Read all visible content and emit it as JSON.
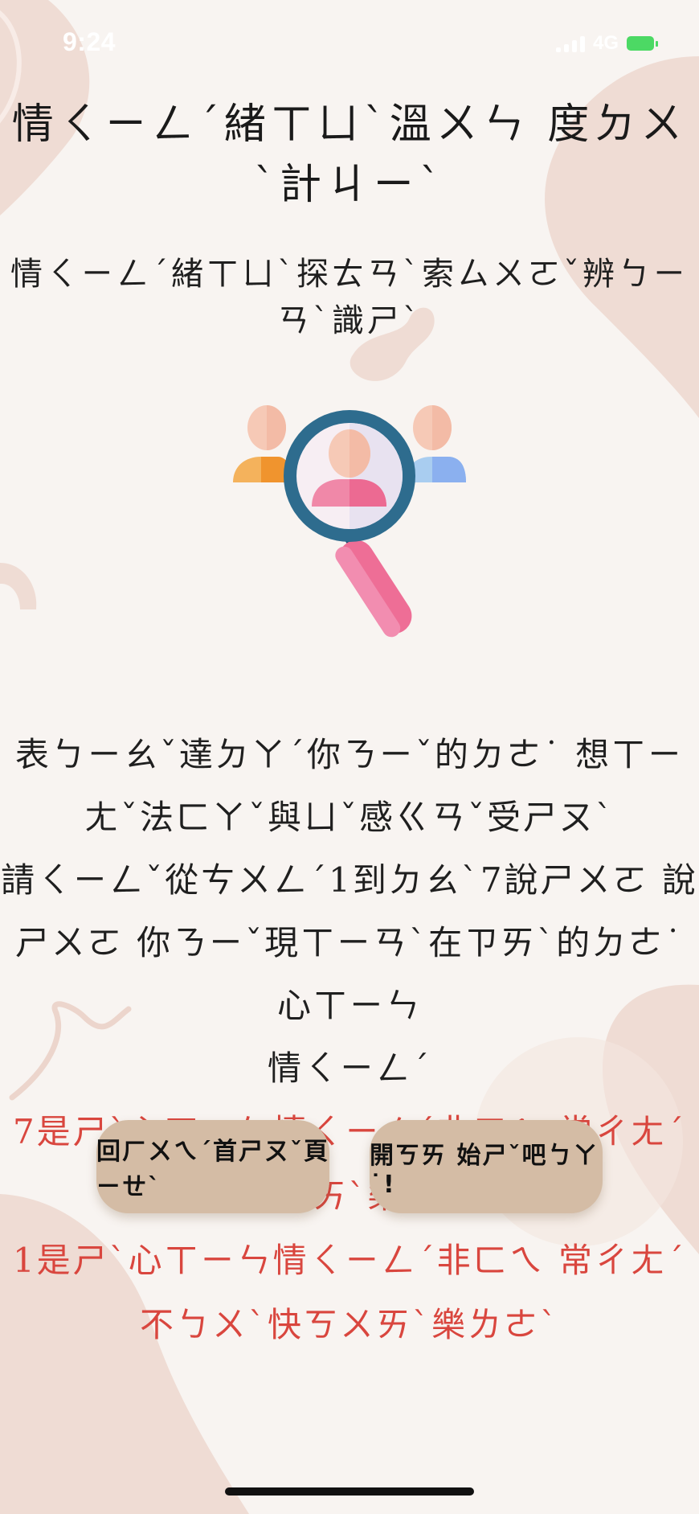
{
  "status_bar": {
    "time": "9:24",
    "network": "4G"
  },
  "header": {
    "title": "情ㄑㄧㄥˊ緒ㄒㄩˋ溫ㄨㄣ 度ㄉㄨˋ計ㄐㄧˋ"
  },
  "main": {
    "subtitle": "情ㄑㄧㄥˊ緒ㄒㄩˋ探ㄊㄢˋ索ㄙㄨㄛˇ辨ㄅㄧㄢˋ識ㄕˋ",
    "illustration_icon": "magnifier-people-icon",
    "instructions": {
      "line1": "表ㄅㄧㄠˇ達ㄉㄚˊ你ㄋㄧˇ的ㄉㄜ˙ 想ㄒㄧㄤˇ法ㄈㄚˇ與ㄩˇ感ㄍㄢˇ受ㄕㄡˋ",
      "line2": "請ㄑㄧㄥˇ從ㄘㄨㄥˊ1到ㄉㄠˋ7說ㄕㄨㄛ 說ㄕㄨㄛ 你ㄋㄧˇ現ㄒㄧㄢˋ在ㄗㄞˋ的ㄉㄜ˙ 心ㄒㄧㄣ",
      "line3": "情ㄑㄧㄥˊ",
      "scale_high": "7是ㄕˋ心ㄒㄧㄣ情ㄑㄧㄥˊ非ㄈㄟ 常ㄔㄤˊ快ㄎㄨㄞˋ樂ㄌㄜˋ",
      "scale_low": "1是ㄕˋ心ㄒㄧㄣ情ㄑㄧㄥˊ非ㄈㄟ 常ㄔㄤˊ不ㄅㄨˋ快ㄎㄨㄞˋ樂ㄌㄜˋ"
    }
  },
  "buttons": {
    "home": "回ㄏㄨㄟˊ首ㄕㄡˇ頁ㄧㄝˋ",
    "start": "開ㄎㄞ 始ㄕˇ吧ㄅㄚ˙!"
  },
  "colors": {
    "background": "#f8f4f1",
    "blob": "#efdcd4",
    "accent_red": "#d9463e",
    "button": "#d4bca5",
    "battery": "#4cd964"
  }
}
